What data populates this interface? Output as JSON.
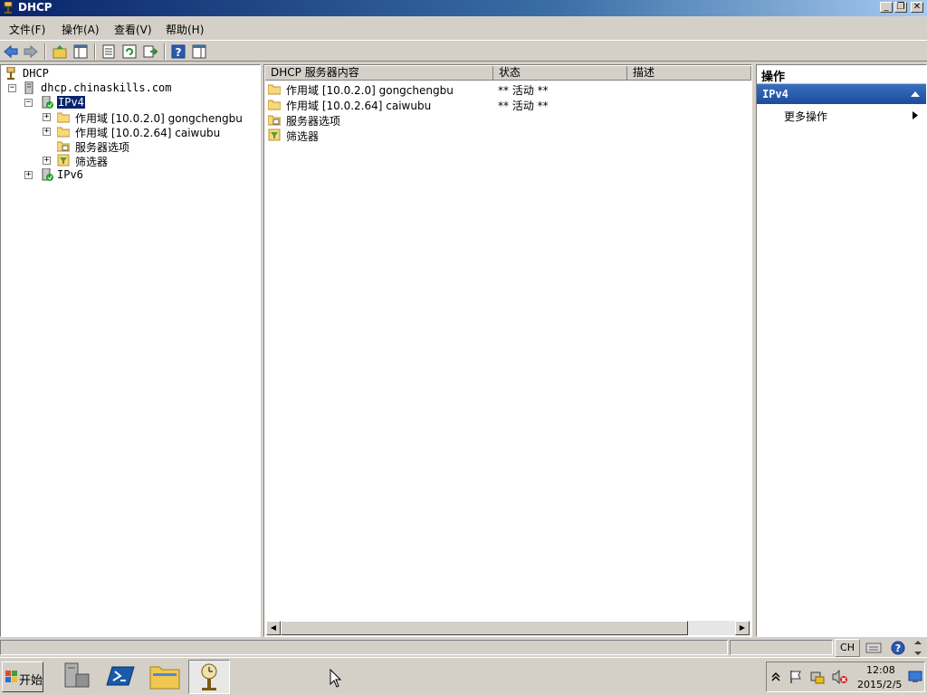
{
  "window": {
    "title": "DHCP"
  },
  "menu": {
    "file": "文件(F)",
    "action": "操作(A)",
    "view": "查看(V)",
    "help": "帮助(H)"
  },
  "tree": {
    "root": "DHCP",
    "server": "dhcp.chinaskills.com",
    "ipv4": "IPv4",
    "scope1": "作用域 [10.0.2.0] gongchengbu",
    "scope2": "作用域 [10.0.2.64] caiwubu",
    "server_options": "服务器选项",
    "filters": "筛选器",
    "ipv6": "IPv6"
  },
  "list": {
    "columns": [
      "DHCP 服务器内容",
      "状态",
      "描述"
    ],
    "rows": [
      {
        "name": "作用域 [10.0.2.0] gongchengbu",
        "status": "** 活动 **",
        "icon": "folder-icon"
      },
      {
        "name": "作用域 [10.0.2.64] caiwubu",
        "status": "** 活动 **",
        "icon": "folder-icon"
      },
      {
        "name": "服务器选项",
        "status": "",
        "icon": "server-options-icon"
      },
      {
        "name": "筛选器",
        "status": "",
        "icon": "filter-icon"
      }
    ]
  },
  "actions": {
    "header": "操作",
    "section": "IPv4",
    "more": "更多操作"
  },
  "taskbar": {
    "start": "开始",
    "language": "CH",
    "time": "12:08",
    "date": "2015/2/5"
  },
  "colors": {
    "title_start": "#0a246a",
    "selection": "#0a246a",
    "action_section": "#1c4c9c"
  }
}
